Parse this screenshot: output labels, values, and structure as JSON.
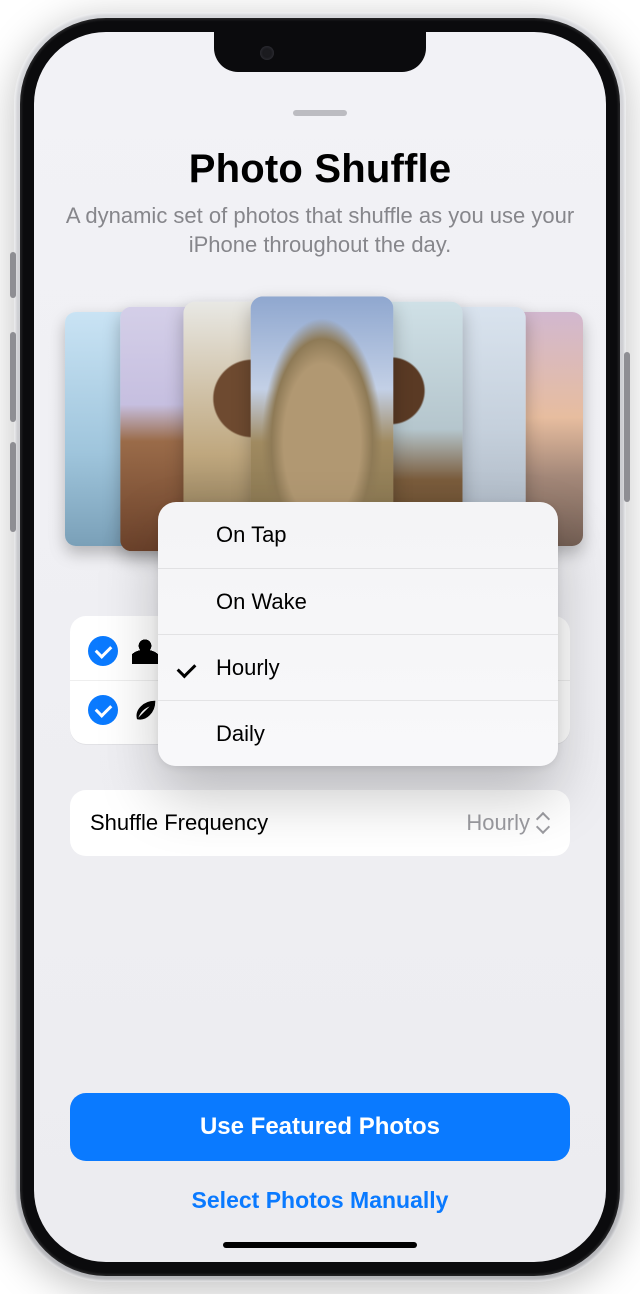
{
  "header": {
    "title": "Photo Shuffle",
    "subtitle": "A dynamic set of photos that shuffle as you use your iPhone throughout the day."
  },
  "categories": {
    "people": {
      "checked": true
    },
    "nature": {
      "checked": true
    }
  },
  "frequency": {
    "label": "Shuffle Frequency",
    "value": "Hourly"
  },
  "popover": {
    "selected_index": 2,
    "items": [
      {
        "label": "On Tap"
      },
      {
        "label": "On Wake"
      },
      {
        "label": "Hourly"
      },
      {
        "label": "Daily"
      }
    ]
  },
  "buttons": {
    "primary": "Use Featured Photos",
    "secondary": "Select Photos Manually"
  }
}
